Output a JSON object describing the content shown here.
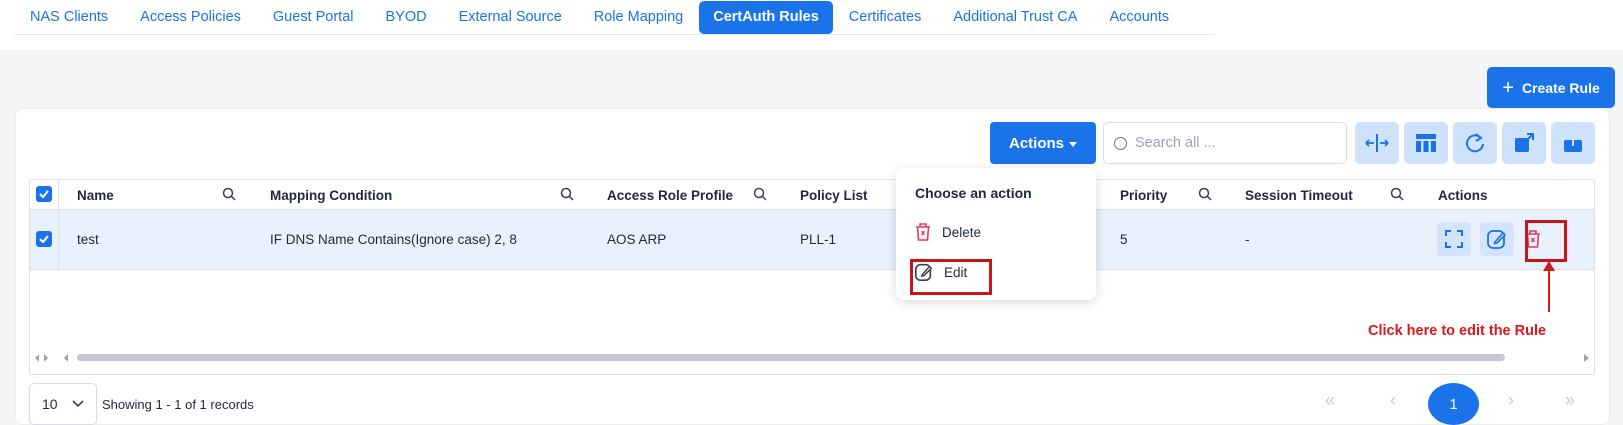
{
  "tabs": [
    {
      "label": "NAS Clients"
    },
    {
      "label": "Access Policies"
    },
    {
      "label": "Guest Portal"
    },
    {
      "label": "BYOD"
    },
    {
      "label": "External Source"
    },
    {
      "label": "Role Mapping"
    },
    {
      "label": "CertAuth Rules",
      "active": true
    },
    {
      "label": "Certificates"
    },
    {
      "label": "Additional Trust CA"
    },
    {
      "label": "Accounts"
    }
  ],
  "create_button": {
    "label": "Create Rule"
  },
  "toolbar": {
    "actions_label": "Actions",
    "search_placeholder": "Search all ...",
    "tools": [
      "resize-columns-icon",
      "columns-layout-icon",
      "refresh-icon",
      "open-external-icon",
      "upload-icon"
    ]
  },
  "table": {
    "columns": [
      "Name",
      "Mapping Condition",
      "Access Role Profile",
      "Policy List",
      "Priority",
      "Session Timeout",
      "Actions"
    ],
    "rows": [
      {
        "selected": true,
        "name": "test",
        "mapping_condition": "IF DNS Name Contains(Ignore case) 2, 8",
        "access_role_profile": "AOS ARP",
        "policy_list": "PLL-1",
        "priority": "5",
        "session_timeout": "-"
      }
    ]
  },
  "menu": {
    "title": "Choose an action",
    "items": [
      {
        "label": "Delete",
        "icon": "trash-icon"
      },
      {
        "label": "Edit",
        "icon": "edit-icon"
      }
    ]
  },
  "pagination": {
    "page_size": "10",
    "showing": "Showing 1 - 1 of 1 records",
    "current_page": "1"
  },
  "annotation": {
    "text": "Click here to edit the Rule"
  },
  "colors": {
    "accent": "#1a73e8",
    "annotation": "#e0161b",
    "selected_row": "#e8f1fc"
  }
}
